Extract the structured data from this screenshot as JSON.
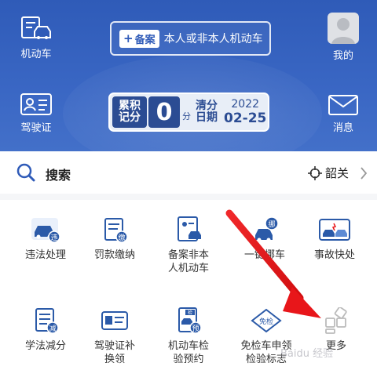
{
  "header": {
    "vehicle_label": "机动车",
    "license_label": "驾驶证",
    "mine_label": "我的",
    "message_label": "消息",
    "backup_badge": "备案",
    "backup_text": "本人或非本人机动车",
    "score": {
      "label_line1": "累积",
      "label_line2": "记分",
      "value": "0",
      "unit": "分",
      "clear_line1": "清分",
      "clear_line2": "日期",
      "year": "2022",
      "date": "02-25"
    }
  },
  "search": {
    "label": "搜索",
    "location": "韶关"
  },
  "services": [
    {
      "line1": "违法处理",
      "line2": ""
    },
    {
      "line1": "罚款缴纳",
      "line2": ""
    },
    {
      "line1": "备案非本",
      "line2": "人机动车"
    },
    {
      "line1": "一键挪车",
      "line2": ""
    },
    {
      "line1": "事故快处",
      "line2": ""
    },
    {
      "line1": "学法减分",
      "line2": ""
    },
    {
      "line1": "驾驶证补",
      "line2": "换领"
    },
    {
      "line1": "机动车检",
      "line2": "验预约"
    },
    {
      "line1": "免检车申领",
      "line2": "检验标志"
    },
    {
      "line1": "更多",
      "line2": ""
    }
  ],
  "icon_badges": {
    "violation": "违",
    "fine": "缴",
    "move": "挪",
    "study": "减",
    "inspect": "检",
    "inspect2": "预",
    "exempt": "免检"
  },
  "watermark": "Baidu 经验",
  "colors": {
    "header_blue": "#2f5bb8",
    "icon_blue": "#2b5aa8",
    "arrow_red": "#e8161a"
  }
}
